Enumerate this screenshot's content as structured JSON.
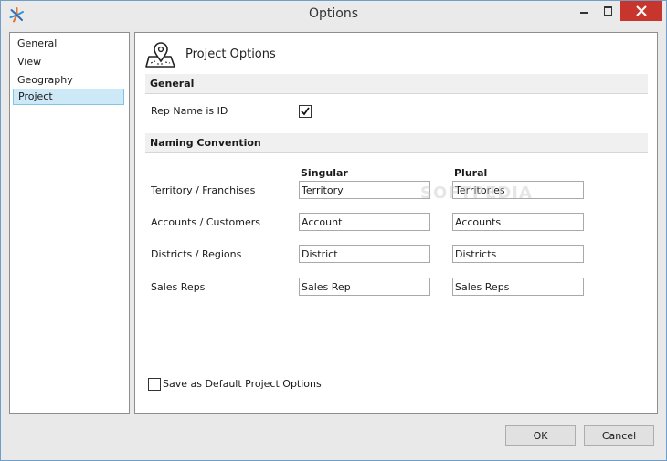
{
  "window": {
    "title": "Options"
  },
  "nav": {
    "items": [
      {
        "label": "General",
        "selected": false
      },
      {
        "label": "View",
        "selected": false
      },
      {
        "label": "Geography",
        "selected": false
      },
      {
        "label": "Project",
        "selected": true
      }
    ]
  },
  "content": {
    "title": "Project Options",
    "icon": "map-pin-icon",
    "general_section": {
      "heading": "General",
      "rep_name_is_id": {
        "label": "Rep Name is ID",
        "checked": true
      }
    },
    "naming_section": {
      "heading": "Naming Convention",
      "col_singular": "Singular",
      "col_plural": "Plural",
      "rows": [
        {
          "label": "Territory / Franchises",
          "singular": "Territory",
          "plural": "Territories"
        },
        {
          "label": "Accounts / Customers",
          "singular": "Account",
          "plural": "Accounts"
        },
        {
          "label": "Districts / Regions",
          "singular": "District",
          "plural": "Districts"
        },
        {
          "label": "Sales Reps",
          "singular": "Sales Rep",
          "plural": "Sales Reps"
        }
      ]
    },
    "save_default": {
      "label": "Save as Default Project Options",
      "checked": false
    },
    "watermark": "SOFTPEDIA"
  },
  "buttons": {
    "ok": "OK",
    "cancel": "Cancel"
  },
  "colors": {
    "close_button": "#c7352c",
    "selected_item_bg": "#cde8f7",
    "selected_item_border": "#82c3e8"
  }
}
